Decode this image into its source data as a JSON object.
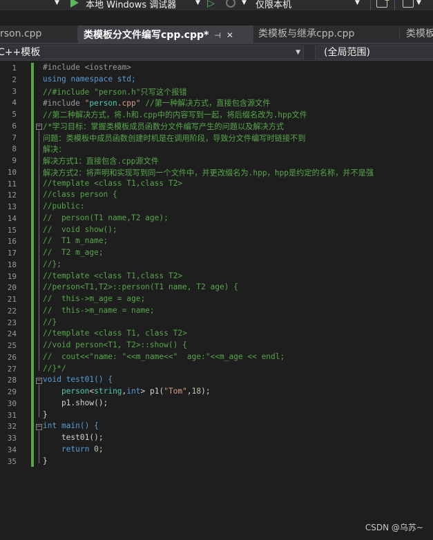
{
  "toolbar": {
    "debugger_label": "本地 Windows 调试器",
    "scope_label": "仅限本机"
  },
  "tabs": [
    {
      "label": "rson.cpp",
      "active": false
    },
    {
      "label": "类模板分文件编写cpp.cpp*",
      "active": true
    },
    {
      "label": "类模板与继承cpp.cpp",
      "active": false
    },
    {
      "label": "类模板",
      "active": false
    }
  ],
  "tab_icons": {
    "pin": "pin-icon",
    "close": "close-icon"
  },
  "nav": {
    "project": "C++模板",
    "scope": "(全局范围)"
  },
  "colors": {
    "comment": "#57a64a",
    "keyword": "#569cd6",
    "string": "#d69d85",
    "type": "#4ec9b0",
    "change_bar": "#57a64a"
  },
  "code_lines": [
    {
      "n": "1",
      "t": "#include <iostream>"
    },
    {
      "n": "2",
      "t": "using namespace std;"
    },
    {
      "n": "3",
      "t": "//#include \"person.h\"只写这个报错"
    },
    {
      "n": "4",
      "t": "#include \"person.cpp\" //第一种解决方式，直接包含源文件"
    },
    {
      "n": "5",
      "t": "//第二种解决方式，将.h和.cpp中的内容写到一起，将后缀名改为.hpp文件"
    },
    {
      "n": "6",
      "t": "/*学习目标：掌握类模板成员函数分文件编写产生的问题以及解决方式"
    },
    {
      "n": "7",
      "t": "问题：类模板中成员函数创建时机是在调用阶段，导致分文件编写时链接不到"
    },
    {
      "n": "8",
      "t": "解决："
    },
    {
      "n": "9",
      "t": "解决方式1：直接包含.cpp源文件"
    },
    {
      "n": "10",
      "t": "解决方式2：将声明和实现写到同一个文件中，并更改缀名为.hpp，hpp是约定的名称，并不是强"
    },
    {
      "n": "11",
      "t": "//template <class T1,class T2>"
    },
    {
      "n": "12",
      "t": "//class person {"
    },
    {
      "n": "13",
      "t": "//public:"
    },
    {
      "n": "14",
      "t": "//  person(T1 name,T2 age);"
    },
    {
      "n": "15",
      "t": "//  void show();"
    },
    {
      "n": "16",
      "t": "//  T1 m_name;"
    },
    {
      "n": "17",
      "t": "//  T2 m_age;"
    },
    {
      "n": "18",
      "t": "//};"
    },
    {
      "n": "19",
      "t": "//template <class T1,class T2>"
    },
    {
      "n": "20",
      "t": "//person<T1,T2>::person(T1 name, T2 age) {"
    },
    {
      "n": "21",
      "t": "//  this->m_age = age;"
    },
    {
      "n": "22",
      "t": "//  this->m_name = name;"
    },
    {
      "n": "23",
      "t": "//}"
    },
    {
      "n": "24",
      "t": "//template <class T1, class T2>"
    },
    {
      "n": "25",
      "t": "//void person<T1, T2>::show() {"
    },
    {
      "n": "26",
      "t": "//  cout<<\"name: \"<<m_name<<\"  age:\"<<m_age << endl;"
    },
    {
      "n": "27",
      "t": "//}*/"
    },
    {
      "n": "28",
      "t": "void test01() {"
    },
    {
      "n": "29",
      "t": "    person<string,int> p1(\"Tom\",18);"
    },
    {
      "n": "30",
      "t": "    p1.show();"
    },
    {
      "n": "31",
      "t": "}"
    },
    {
      "n": "32",
      "t": "int main() {"
    },
    {
      "n": "33",
      "t": "    test01();"
    },
    {
      "n": "34",
      "t": "    return 0;"
    },
    {
      "n": "35",
      "t": "}"
    }
  ],
  "watermark": "CSDN @乌苏~"
}
